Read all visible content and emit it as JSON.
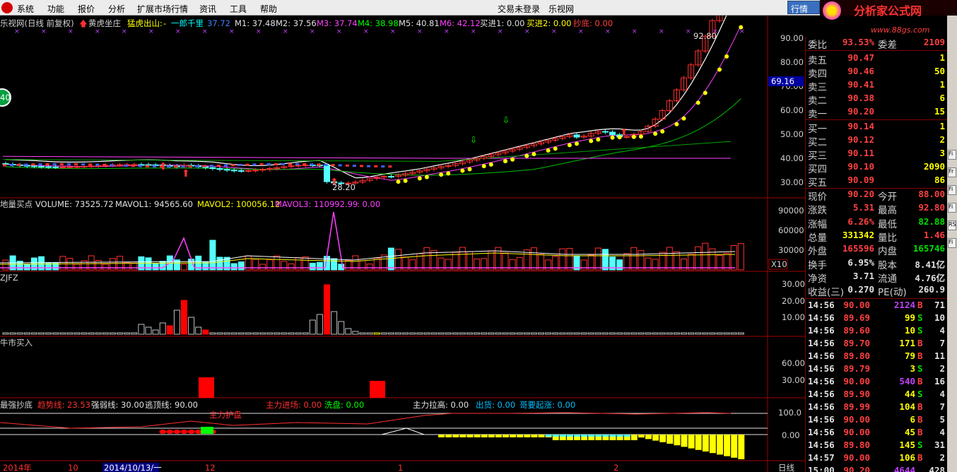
{
  "menu": {
    "items": [
      "系统",
      "功能",
      "报价",
      "分析",
      "扩展市场行情",
      "资讯",
      "工具",
      "帮助"
    ],
    "login_status": "交易未登录",
    "app_name": "乐视网",
    "right_tab": "行情",
    "brand": "分析家公式网",
    "brand_url": "www.88gs.com"
  },
  "main_chart": {
    "title": "乐视网(日线 前复权)",
    "indicator_name": "黄虎坐庄",
    "ind_label1": "猛虎出山:",
    "ind_label1_val": "-",
    "ind_label2": "一郎千里",
    "ind_label2_val": "37.72",
    "m1": "M1: 37.48",
    "m2": "M2: 37.56",
    "m3": "M3: 37.74",
    "m4": "M4: 38.98",
    "m5": "M5: 40.81",
    "m6": "M6: 42.12",
    "buy1": "买进1: 0.00",
    "buy2": "买进2: 0.00",
    "bottom": "抄底: 0.00",
    "high_label": "92.80",
    "low_label": "28.20",
    "axis": [
      "90.00",
      "80.00",
      "70.00",
      "60.00",
      "50.00",
      "40.00",
      "30.00"
    ],
    "cursor_price": "69.16",
    "badge": "40"
  },
  "volume_chart": {
    "title": "地量买点",
    "vol": "VOLUME: 73525.72",
    "mavol1": "MAVOL1: 94565.60",
    "mavol2": "MAVOL2: 100056.12",
    "mavol3": "MAVOL3: 110992.99",
    "extra": ": 0.00",
    "axis": [
      "90000",
      "60000",
      "30000"
    ],
    "unit": "X10"
  },
  "zjfz_chart": {
    "title": "ZJFZ",
    "axis": [
      "30.00",
      "20.00",
      "10.00"
    ]
  },
  "niu_chart": {
    "title": "牛市买入",
    "axis": [
      "60.00",
      "30.00"
    ]
  },
  "bottom_chart": {
    "title": "最强抄底",
    "trend": "趋势线: 23.53",
    "strength": "强弱线: 30.00",
    "escape": "逃顶线: 90.00",
    "main_in": "主力进场: 0.00",
    "wash": "洗盘: 0.00",
    "main_up": "主力拉高: 0.00",
    "out": "出货: 0.00",
    "rise": "哥要起涨: 0.00",
    "axis": [
      "100.0",
      "0.00"
    ],
    "mark": "主力护盘"
  },
  "time_axis": {
    "labels": [
      "2014年",
      "10",
      "2014/10/13/一",
      "12",
      "1",
      "2"
    ],
    "period": "日线"
  },
  "quote": {
    "wei": {
      "lab": "委比",
      "v1": "93.53%",
      "lab2": "委差",
      "v2": "2109"
    },
    "sells": [
      {
        "lab": "卖五",
        "price": "90.47",
        "vol": "1"
      },
      {
        "lab": "卖四",
        "price": "90.46",
        "vol": "50"
      },
      {
        "lab": "卖三",
        "price": "90.41",
        "vol": "1"
      },
      {
        "lab": "卖二",
        "price": "90.38",
        "vol": "6"
      },
      {
        "lab": "卖一",
        "price": "90.20",
        "vol": "15"
      }
    ],
    "buys": [
      {
        "lab": "买一",
        "price": "90.14",
        "vol": "1"
      },
      {
        "lab": "买二",
        "price": "90.12",
        "vol": "2"
      },
      {
        "lab": "买三",
        "price": "90.11",
        "vol": "3"
      },
      {
        "lab": "买四",
        "price": "90.10",
        "vol": "2090"
      },
      {
        "lab": "买五",
        "price": "90.09",
        "vol": "86"
      }
    ],
    "stats": [
      {
        "lab": "现价",
        "v1": "90.20",
        "lab2": "今开",
        "v2": "88.00",
        "c1": "red",
        "c2": "red"
      },
      {
        "lab": "涨跌",
        "v1": "5.31",
        "lab2": "最高",
        "v2": "92.80",
        "c1": "red",
        "c2": "red"
      },
      {
        "lab": "涨幅",
        "v1": "6.26%",
        "lab2": "最低",
        "v2": "82.88",
        "c1": "red",
        "c2": "green"
      },
      {
        "lab": "总量",
        "v1": "331342",
        "lab2": "量比",
        "v2": "1.46",
        "c1": "yellow",
        "c2": "red"
      },
      {
        "lab": "外盘",
        "v1": "165596",
        "lab2": "内盘",
        "v2": "165746",
        "c1": "red",
        "c2": "green"
      },
      {
        "lab": "换手",
        "v1": "6.95%",
        "lab2": "股本",
        "v2": "8.41亿",
        "c1": "white",
        "c2": "white"
      },
      {
        "lab": "净资",
        "v1": "3.71",
        "lab2": "流通",
        "v2": "4.76亿",
        "c1": "white",
        "c2": "white"
      },
      {
        "lab": "收益(三)",
        "v1": "0.270",
        "lab2": "PE(动)",
        "v2": "260.9",
        "c1": "white",
        "c2": "white"
      }
    ],
    "ticks": [
      {
        "t": "14:56",
        "p": "90.00",
        "v": "2124",
        "s": "B",
        "n": "71",
        "pc": "red",
        "vc": "purple"
      },
      {
        "t": "14:56",
        "p": "89.69",
        "v": "99",
        "s": "S",
        "n": "10",
        "pc": "red",
        "vc": "yellow"
      },
      {
        "t": "14:56",
        "p": "89.60",
        "v": "10",
        "s": "S",
        "n": "4",
        "pc": "red",
        "vc": "yellow"
      },
      {
        "t": "14:56",
        "p": "89.70",
        "v": "171",
        "s": "B",
        "n": "7",
        "pc": "red",
        "vc": "yellow"
      },
      {
        "t": "14:56",
        "p": "89.80",
        "v": "79",
        "s": "B",
        "n": "11",
        "pc": "red",
        "vc": "yellow"
      },
      {
        "t": "14:56",
        "p": "89.79",
        "v": "3",
        "s": "S",
        "n": "2",
        "pc": "red",
        "vc": "yellow"
      },
      {
        "t": "14:56",
        "p": "90.00",
        "v": "540",
        "s": "B",
        "n": "16",
        "pc": "red",
        "vc": "purple"
      },
      {
        "t": "14:56",
        "p": "89.90",
        "v": "44",
        "s": "S",
        "n": "4",
        "pc": "red",
        "vc": "yellow"
      },
      {
        "t": "14:56",
        "p": "89.99",
        "v": "104",
        "s": "B",
        "n": "7",
        "pc": "red",
        "vc": "yellow"
      },
      {
        "t": "14:56",
        "p": "90.00",
        "v": "6",
        "s": "B",
        "n": "5",
        "pc": "red",
        "vc": "yellow"
      },
      {
        "t": "14:56",
        "p": "90.00",
        "v": "45",
        "s": "B",
        "n": "4",
        "pc": "red",
        "vc": "yellow"
      },
      {
        "t": "14:56",
        "p": "89.80",
        "v": "145",
        "s": "S",
        "n": "31",
        "pc": "red",
        "vc": "yellow"
      },
      {
        "t": "14:57",
        "p": "90.00",
        "v": "106",
        "s": "B",
        "n": "2",
        "pc": "red",
        "vc": "yellow"
      },
      {
        "t": "15:00",
        "p": "90.20",
        "v": "4644",
        "s": "",
        "n": "428",
        "pc": "red",
        "vc": "purple"
      }
    ]
  },
  "right_toolbar": [
    "Fi",
    "Fr",
    "Fi",
    "Fi",
    "RS",
    "Fi"
  ]
}
